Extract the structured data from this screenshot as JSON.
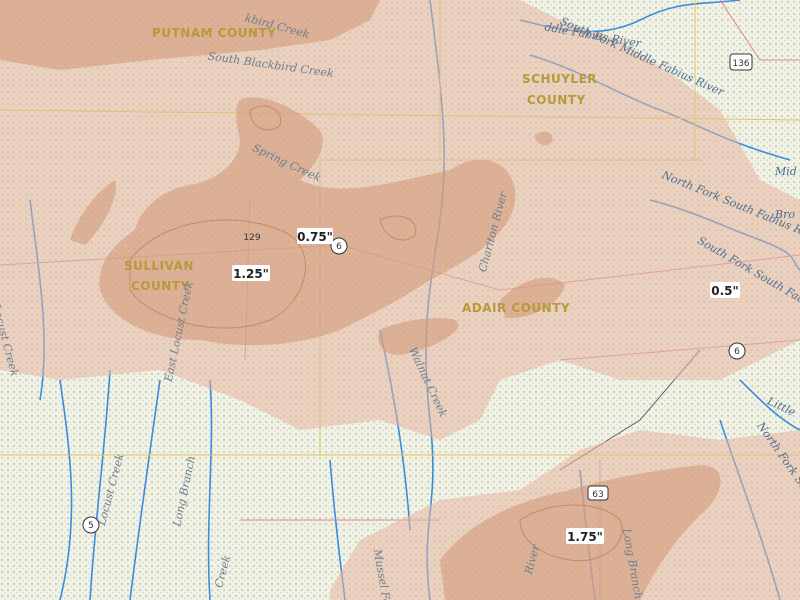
{
  "colors": {
    "land": "#f3f1eb",
    "forest": "#cfdcb0",
    "water": "#3a8ddc",
    "precip_light": "#e8b8a0",
    "precip_mid": "#d79a7a",
    "precip_heavy": "#c2784f",
    "county_line": "#e0c850",
    "road": "#d98a8a"
  },
  "counties": [
    {
      "name": "PUTNAM COUNTY"
    },
    {
      "name": "SCHUYLER\nCOUNTY",
      "line1": "SCHUYLER",
      "line2": "COUNTY"
    },
    {
      "name": "SULLIVAN COUNTY",
      "line1": "SULLIVAN",
      "line2": "COUNTY"
    },
    {
      "name": "ADAIR COUNTY"
    }
  ],
  "waterways": [
    "South Fork Middle Fabius River",
    "ddle Fabius River",
    "South Blackbird Creek",
    "kbird Creek",
    "Spring Creek",
    "Chariton River",
    "West Locust Creek",
    "East Locust Creek",
    "Locust Creek",
    "Long Branch",
    "Walnut Creek",
    "North Fork South Fabius River",
    "South Fork South Fabius River",
    "North Fork Salt River",
    "Mussel Fork",
    "Little",
    "Mid",
    "Bro",
    "Creek",
    "River",
    "Long Branch"
  ],
  "rainfall_labels": [
    {
      "text": "0.75\"",
      "name": "rain-label-075"
    },
    {
      "text": "1.25\"",
      "name": "rain-label-125"
    },
    {
      "text": "0.5\"",
      "name": "rain-label-05"
    },
    {
      "text": "1.75\"",
      "name": "rain-label-175"
    }
  ],
  "route_shields": [
    "136",
    "129",
    "6",
    "6",
    "63",
    "5"
  ]
}
